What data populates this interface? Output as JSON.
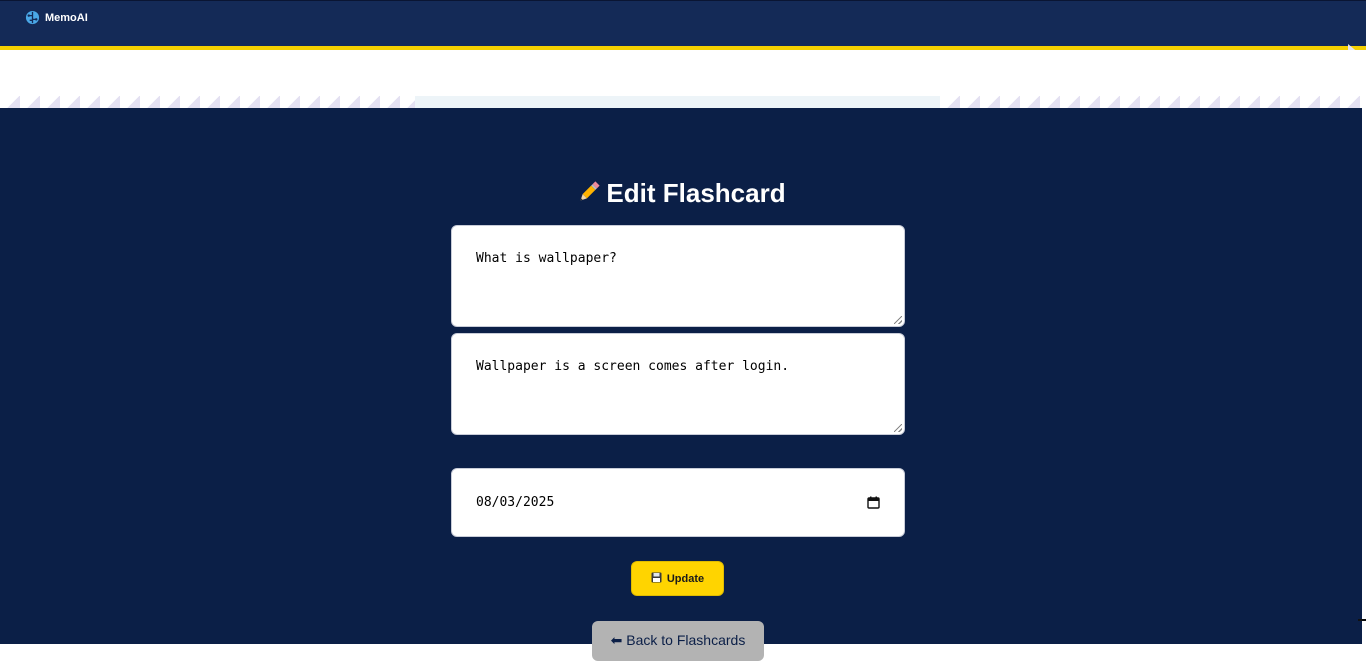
{
  "brand": {
    "name": "MemoAI",
    "icon": "brain-icon"
  },
  "page": {
    "title": "Edit Flashcard",
    "title_icon": "pencil-icon"
  },
  "form": {
    "question": "What is wallpaper?",
    "answer": "Wallpaper is a screen comes after login.",
    "date": "08/03/2025"
  },
  "buttons": {
    "update_label": "Update",
    "update_icon": "floppy-disk-icon",
    "back_label": "⬅ Back to Flashcards"
  },
  "colors": {
    "navbar": "#142a57",
    "main_bg": "#0b1f47",
    "accent_yellow": "#ffd400",
    "back_button": "#b3b3b3"
  }
}
